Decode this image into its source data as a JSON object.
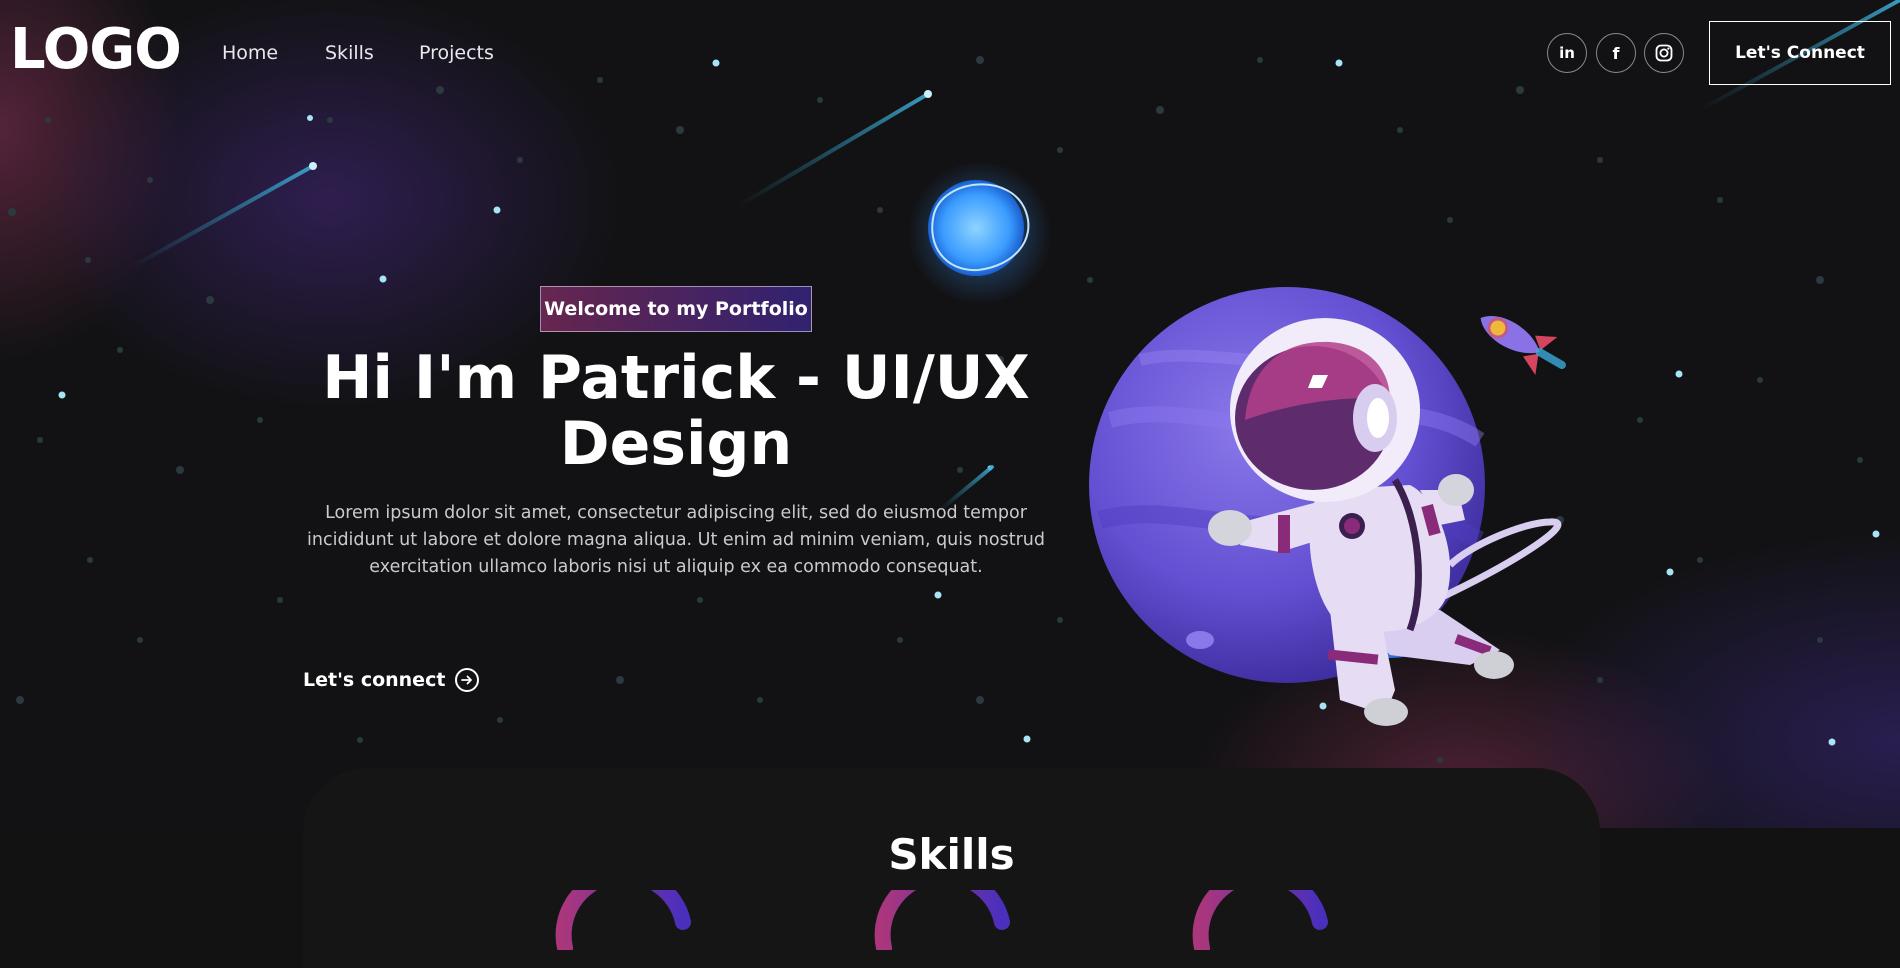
{
  "nav": {
    "logo": "LOGO",
    "links": [
      "Home",
      "Skills",
      "Projects"
    ],
    "social": [
      {
        "name": "linkedin",
        "glyph": "in"
      },
      {
        "name": "facebook",
        "glyph": "f"
      },
      {
        "name": "instagram",
        "glyph": ""
      }
    ],
    "connect_label": "Let's Connect"
  },
  "hero": {
    "tagline": "Welcome to my Portfolio",
    "headline_line1": "Hi I'm Patrick - UI/UX",
    "headline_line2": "Design",
    "intro": "Lorem ipsum dolor sit amet, consectetur adipiscing elit, sed do eiusmod tempor incididunt ut labore et dolore magna aliqua. Ut enim ad minim veniam, quis nostrud exercitation ullamco laboris nisi ut aliquip ex ea commodo consequat.",
    "cta_label": "Let's connect"
  },
  "skills": {
    "title": "Skills"
  },
  "colors": {
    "background": "#121212",
    "accent_pink": "#aa367c",
    "accent_purple": "#4a2fbd",
    "planet": "#6a55d8"
  }
}
